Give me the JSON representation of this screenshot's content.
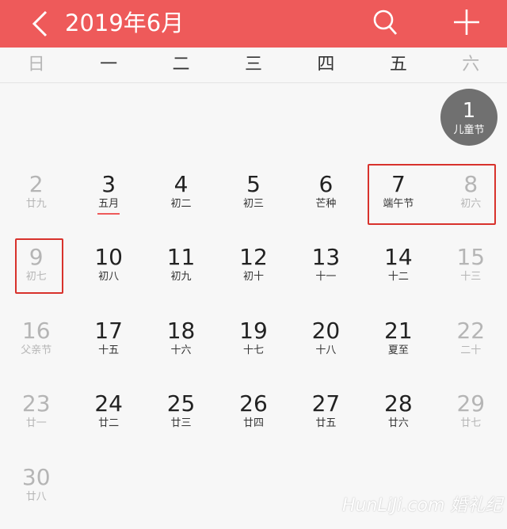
{
  "header": {
    "title": "2019年6月",
    "background_color": "#ee5a5a"
  },
  "weekdays": [
    "日",
    "一",
    "二",
    "三",
    "四",
    "五",
    "六"
  ],
  "days": [
    {
      "day": "1",
      "lunar": "儿童节",
      "col": 6,
      "row": 0,
      "weekend": true,
      "today": true
    },
    {
      "day": "2",
      "lunar": "廿九",
      "col": 0,
      "row": 1,
      "weekend": true
    },
    {
      "day": "3",
      "lunar": "五月",
      "col": 1,
      "row": 1,
      "underline": true
    },
    {
      "day": "4",
      "lunar": "初二",
      "col": 2,
      "row": 1
    },
    {
      "day": "5",
      "lunar": "初三",
      "col": 3,
      "row": 1
    },
    {
      "day": "6",
      "lunar": "芒种",
      "col": 4,
      "row": 1
    },
    {
      "day": "7",
      "lunar": "端午节",
      "col": 5,
      "row": 1
    },
    {
      "day": "8",
      "lunar": "初六",
      "col": 6,
      "row": 1,
      "weekend": true
    },
    {
      "day": "9",
      "lunar": "初七",
      "col": 0,
      "row": 2,
      "weekend": true
    },
    {
      "day": "10",
      "lunar": "初八",
      "col": 1,
      "row": 2
    },
    {
      "day": "11",
      "lunar": "初九",
      "col": 2,
      "row": 2
    },
    {
      "day": "12",
      "lunar": "初十",
      "col": 3,
      "row": 2
    },
    {
      "day": "13",
      "lunar": "十一",
      "col": 4,
      "row": 2
    },
    {
      "day": "14",
      "lunar": "十二",
      "col": 5,
      "row": 2
    },
    {
      "day": "15",
      "lunar": "十三",
      "col": 6,
      "row": 2,
      "weekend": true
    },
    {
      "day": "16",
      "lunar": "父亲节",
      "col": 0,
      "row": 3,
      "weekend": true
    },
    {
      "day": "17",
      "lunar": "十五",
      "col": 1,
      "row": 3
    },
    {
      "day": "18",
      "lunar": "十六",
      "col": 2,
      "row": 3
    },
    {
      "day": "19",
      "lunar": "十七",
      "col": 3,
      "row": 3
    },
    {
      "day": "20",
      "lunar": "十八",
      "col": 4,
      "row": 3
    },
    {
      "day": "21",
      "lunar": "夏至",
      "col": 5,
      "row": 3
    },
    {
      "day": "22",
      "lunar": "二十",
      "col": 6,
      "row": 3,
      "weekend": true
    },
    {
      "day": "23",
      "lunar": "廿一",
      "col": 0,
      "row": 4,
      "weekend": true
    },
    {
      "day": "24",
      "lunar": "廿二",
      "col": 1,
      "row": 4
    },
    {
      "day": "25",
      "lunar": "廿三",
      "col": 2,
      "row": 4
    },
    {
      "day": "26",
      "lunar": "廿四",
      "col": 3,
      "row": 4
    },
    {
      "day": "27",
      "lunar": "廿五",
      "col": 4,
      "row": 4
    },
    {
      "day": "28",
      "lunar": "廿六",
      "col": 5,
      "row": 4
    },
    {
      "day": "29",
      "lunar": "廿七",
      "col": 6,
      "row": 4,
      "weekend": true
    },
    {
      "day": "30",
      "lunar": "廿八",
      "col": 0,
      "row": 5,
      "weekend": true
    }
  ],
  "watermark": "HunLiJi.com 婚礼纪",
  "icons": {
    "back": "chevron-left-icon",
    "search": "search-icon",
    "add": "plus-icon"
  }
}
